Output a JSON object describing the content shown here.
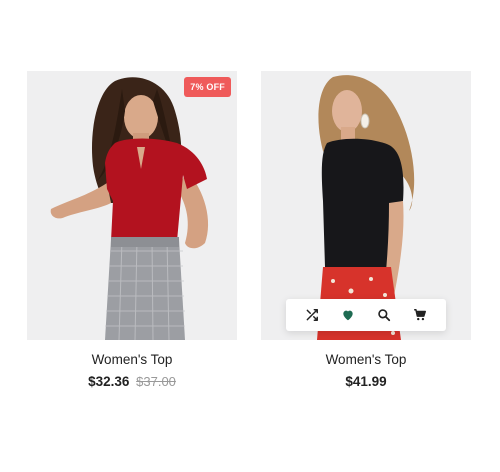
{
  "products": [
    {
      "title": "Women's Top",
      "price": "$32.36",
      "old_price": "$37.00",
      "badge": "7% OFF",
      "badge_color": "#ef5a5a"
    },
    {
      "title": "Women's Top",
      "price": "$41.99",
      "actions": [
        {
          "icon": "shuffle-icon",
          "label": "compare"
        },
        {
          "icon": "heart-icon",
          "label": "wishlist",
          "color": "#1e6b52"
        },
        {
          "icon": "search-icon",
          "label": "quick view"
        },
        {
          "icon": "cart-icon",
          "label": "add to cart"
        }
      ]
    }
  ]
}
